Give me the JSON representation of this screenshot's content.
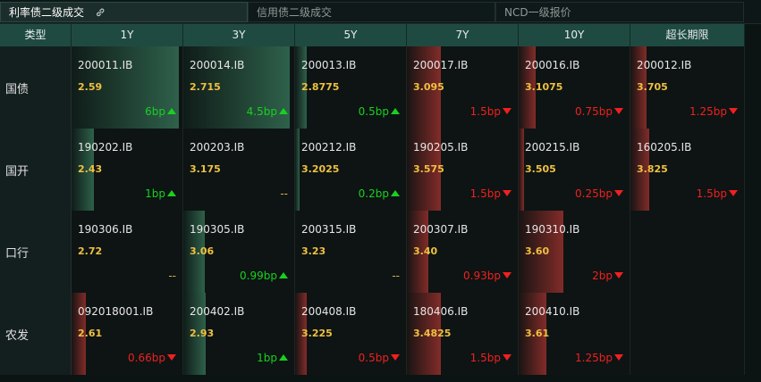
{
  "tabs": [
    {
      "label": "利率债二级成交",
      "active": true
    },
    {
      "label": "信用债二级成交",
      "active": false
    },
    {
      "label": "NCD一级报价",
      "active": false
    }
  ],
  "columns": [
    "类型",
    "1Y",
    "3Y",
    "5Y",
    "7Y",
    "10Y",
    "超长期限"
  ],
  "rows": [
    {
      "label": "国债",
      "cells": [
        {
          "code": "200011.IB",
          "yield": "2.59",
          "change": "6bp",
          "dir": "up",
          "level": 0.96
        },
        {
          "code": "200014.IB",
          "yield": "2.715",
          "change": "4.5bp",
          "dir": "up",
          "level": 0.95
        },
        {
          "code": "200013.IB",
          "yield": "2.8775",
          "change": "0.5bp",
          "dir": "up",
          "level": 0.1
        },
        {
          "code": "200017.IB",
          "yield": "3.095",
          "change": "1.5bp",
          "dir": "down",
          "level": 0.3
        },
        {
          "code": "200016.IB",
          "yield": "3.1075",
          "change": "0.75bp",
          "dir": "down",
          "level": 0.15
        },
        {
          "code": "200012.IB",
          "yield": "3.705",
          "change": "1.25bp",
          "dir": "down",
          "level": 0.14
        }
      ]
    },
    {
      "label": "国开",
      "cells": [
        {
          "code": "190202.IB",
          "yield": "2.43",
          "change": "1bp",
          "dir": "up",
          "level": 0.2
        },
        {
          "code": "200203.IB",
          "yield": "3.175",
          "change": "--",
          "dir": "flat",
          "level": 0
        },
        {
          "code": "200212.IB",
          "yield": "3.2025",
          "change": "0.2bp",
          "dir": "up",
          "level": 0.04
        },
        {
          "code": "190205.IB",
          "yield": "3.575",
          "change": "1.5bp",
          "dir": "down",
          "level": 0.3
        },
        {
          "code": "200215.IB",
          "yield": "3.505",
          "change": "0.25bp",
          "dir": "down",
          "level": 0.05
        },
        {
          "code": "160205.IB",
          "yield": "3.825",
          "change": "1.5bp",
          "dir": "down",
          "level": 0.17
        }
      ]
    },
    {
      "label": "口行",
      "cells": [
        {
          "code": "190306.IB",
          "yield": "2.72",
          "change": "--",
          "dir": "flat",
          "level": 0
        },
        {
          "code": "190305.IB",
          "yield": "3.06",
          "change": "0.99bp",
          "dir": "up",
          "level": 0.19
        },
        {
          "code": "200315.IB",
          "yield": "3.23",
          "change": "--",
          "dir": "flat",
          "level": 0
        },
        {
          "code": "200307.IB",
          "yield": "3.40",
          "change": "0.93bp",
          "dir": "down",
          "level": 0.19
        },
        {
          "code": "190310.IB",
          "yield": "3.60",
          "change": "2bp",
          "dir": "down",
          "level": 0.4
        },
        {
          "code": "",
          "yield": "",
          "change": "",
          "dir": "none",
          "level": 0
        }
      ]
    },
    {
      "label": "农发",
      "cells": [
        {
          "code": "092018001.IB",
          "yield": "2.61",
          "change": "0.66bp",
          "dir": "down",
          "level": 0.13
        },
        {
          "code": "200402.IB",
          "yield": "2.93",
          "change": "1bp",
          "dir": "up",
          "level": 0.2
        },
        {
          "code": "200408.IB",
          "yield": "3.225",
          "change": "0.5bp",
          "dir": "down",
          "level": 0.1
        },
        {
          "code": "180406.IB",
          "yield": "3.4825",
          "change": "1.5bp",
          "dir": "down",
          "level": 0.3
        },
        {
          "code": "200410.IB",
          "yield": "3.61",
          "change": "1.25bp",
          "dir": "down",
          "level": 0.25
        },
        {
          "code": "",
          "yield": "",
          "change": "",
          "dir": "none",
          "level": 0
        }
      ]
    }
  ]
}
